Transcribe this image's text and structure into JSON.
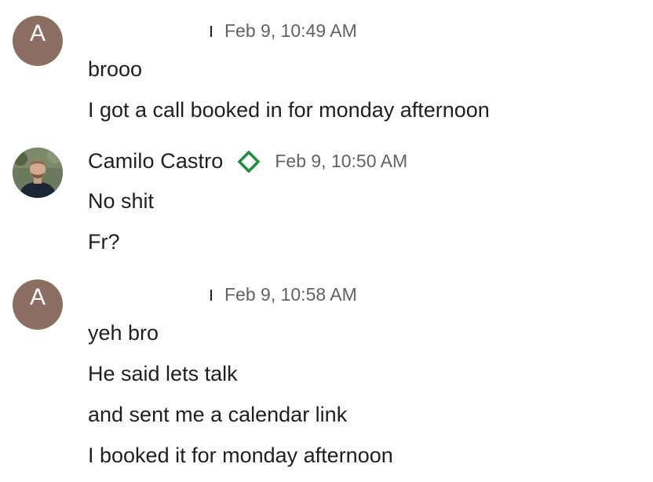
{
  "messages": [
    {
      "sender": "",
      "avatar_letter": "A",
      "timestamp": "Feb 9, 10:49 AM",
      "lines": [
        "brooo",
        "I got a call booked in for monday afternoon"
      ]
    },
    {
      "sender": "Camilo Castro",
      "verified_icon": "diamond-outline-icon",
      "verified_color": "#1e8e3e",
      "timestamp": "Feb 9, 10:50 AM",
      "lines": [
        "No shit",
        "Fr?"
      ]
    },
    {
      "sender": "",
      "avatar_letter": "A",
      "timestamp": "Feb 9, 10:58 AM",
      "lines": [
        "yeh bro",
        "He said lets talk",
        "and sent me a calendar link",
        "I booked it for monday afternoon"
      ]
    }
  ],
  "colors": {
    "letter_avatar_bg": "#8d6e63",
    "timestamp": "#5f6368",
    "text": "#1f1f1f"
  }
}
